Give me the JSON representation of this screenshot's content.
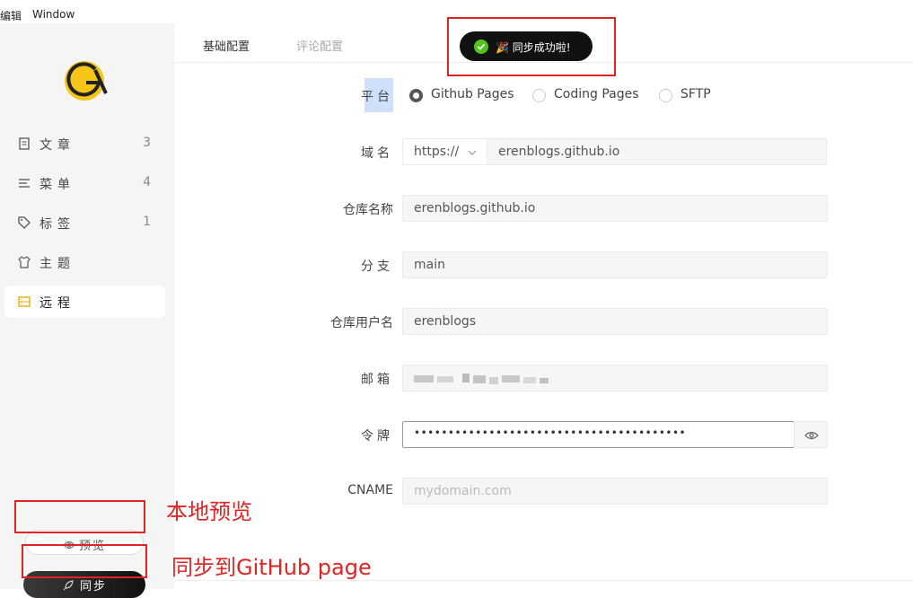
{
  "menubar": {
    "edit": "编辑",
    "window": "Window"
  },
  "sidebar": {
    "items": [
      {
        "label": "文章",
        "count": "3",
        "icon": "document-icon"
      },
      {
        "label": "菜单",
        "count": "4",
        "icon": "menu-icon"
      },
      {
        "label": "标签",
        "count": "1",
        "icon": "tag-icon"
      },
      {
        "label": "主题",
        "count": "",
        "icon": "shirt-icon"
      },
      {
        "label": "远程",
        "count": "",
        "icon": "server-icon"
      }
    ],
    "preview_label": "预览",
    "sync_label": "同步"
  },
  "annotations": {
    "preview": "本地预览",
    "sync": "同步到GitHub page"
  },
  "tabs": {
    "basic": "基础配置",
    "comments": "评论配置"
  },
  "toast": {
    "message": "🎉 同步成功啦!"
  },
  "form": {
    "platform_label": "平台",
    "platforms": [
      "Github Pages",
      "Coding Pages",
      "SFTP"
    ],
    "selected_platform": "Github Pages",
    "domain_label": "域名",
    "protocol": "https://",
    "domain": "erenblogs.github.io",
    "repo_label": "仓库名称",
    "repo": "erenblogs.github.io",
    "branch_label": "分支",
    "branch": "main",
    "username_label": "仓库用户名",
    "username": "erenblogs",
    "email_label": "邮箱",
    "token_label": "令牌",
    "token": "••••••••••••••••••••••••••••••••••••••••",
    "cname_label": "CNAME",
    "cname_placeholder": "mydomain.com"
  },
  "colors": {
    "accent": "#f5c518",
    "annotation": "#e02424",
    "toast_bg": "#111111",
    "success": "#52c41a"
  }
}
